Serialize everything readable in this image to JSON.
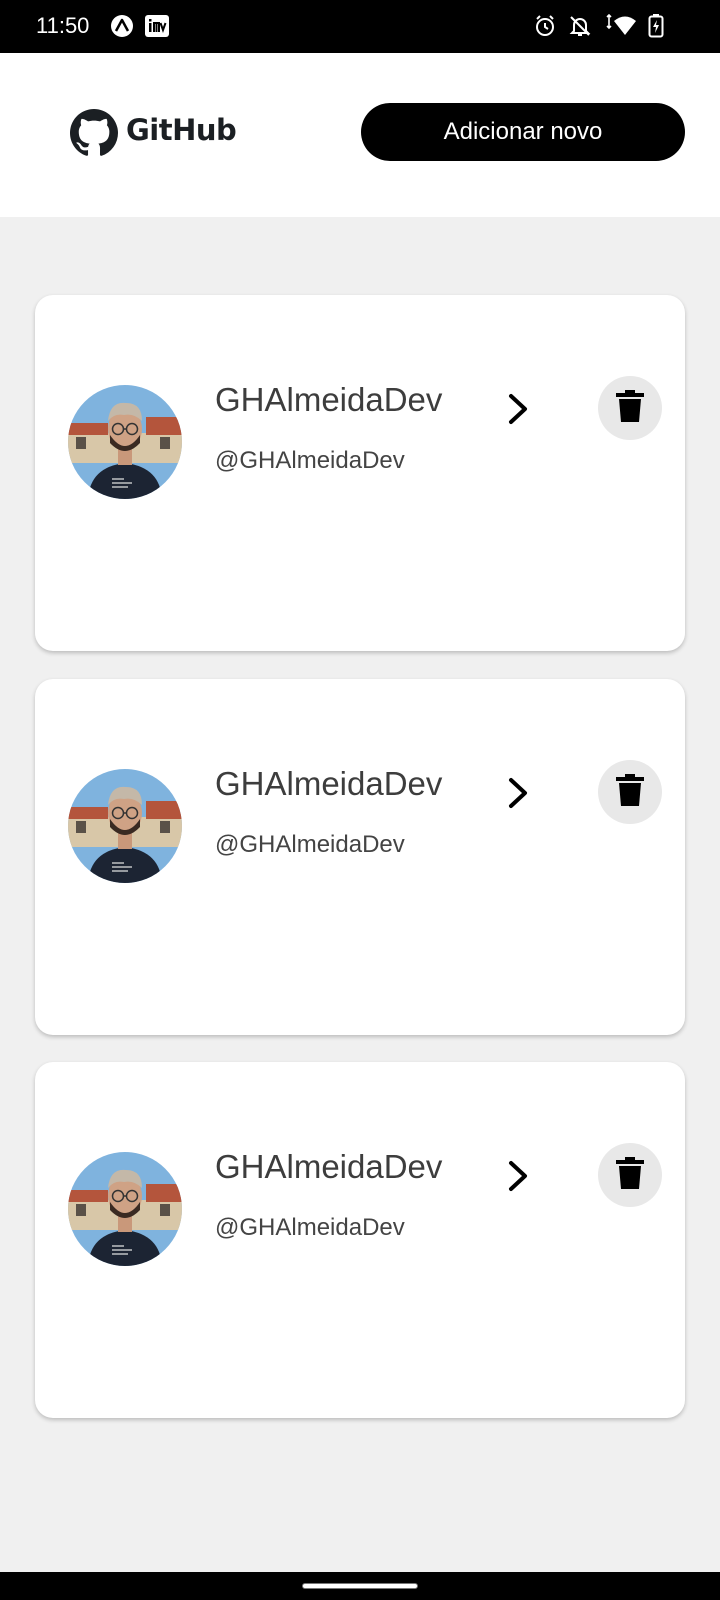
{
  "status_bar": {
    "time": "11:50",
    "app_icons": [
      "expo-icon",
      "inv-icon"
    ],
    "status_icons": [
      "alarm-icon",
      "notifications-off-icon",
      "wifi-icon",
      "battery-charging-icon"
    ]
  },
  "header": {
    "logo_text": "GitHub",
    "add_button_label": "Adicionar novo"
  },
  "users": [
    {
      "name": "GHAlmeidaDev",
      "handle": "@GHAlmeidaDev"
    },
    {
      "name": "GHAlmeidaDev",
      "handle": "@GHAlmeidaDev"
    },
    {
      "name": "GHAlmeidaDev",
      "handle": "@GHAlmeidaDev"
    }
  ],
  "colors": {
    "background": "#f0f0f0",
    "card": "#ffffff",
    "primary_button": "#000000",
    "delete_button_bg": "#e8e8e8"
  }
}
